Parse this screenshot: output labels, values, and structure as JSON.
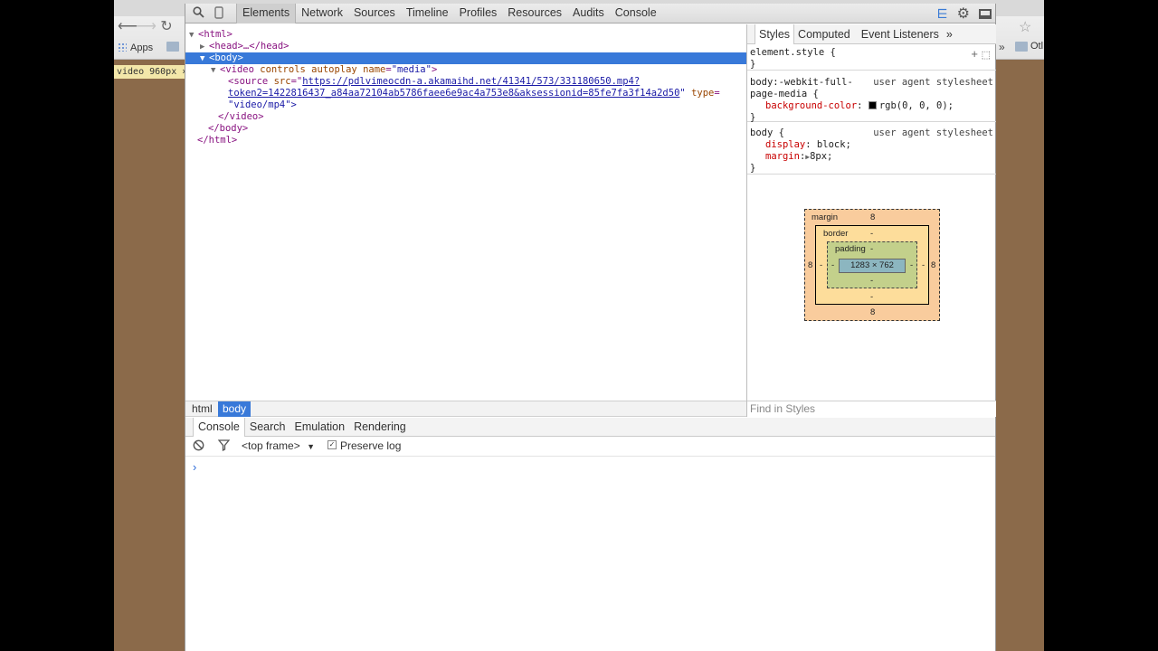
{
  "browser": {
    "bookmarks_apps": "Apps",
    "bookmarks_other": "Otl",
    "size_overlay": "video 960px ×"
  },
  "toolbar": {
    "tabs": [
      "Elements",
      "Network",
      "Sources",
      "Timeline",
      "Profiles",
      "Resources",
      "Audits",
      "Console"
    ]
  },
  "dom": {
    "html_open": "<html>",
    "head": "<head>…</head>",
    "body_open": "<body>",
    "video_tag": "<video",
    "video_attr1_name": "controls",
    "video_attr2_name": "autoplay",
    "video_attr3_name": "name",
    "video_attr3_val": "\"media\"",
    "video_close_bracket": ">",
    "source_tag": "<source",
    "source_src_name": "src",
    "source_src_url_line1": "https://pdlvimeocdn-a.akamaihd.net/41341/573/331180650.mp4?",
    "source_src_url_line2": "token2=1422816437_a84aa72104ab5786faee6e9ac4a753e8&aksessionid=85fe7fa3f14a2d50",
    "source_type_name": "type",
    "source_type_val": "\"video/mp4\">",
    "video_end": "</video>",
    "body_end": "</body>",
    "html_end": "</html>"
  },
  "breadcrumb": {
    "items": [
      "html",
      "body"
    ]
  },
  "sidebar": {
    "tabs": [
      "Styles",
      "Computed",
      "Event Listeners",
      "»"
    ],
    "rule1_selector": "element.style {",
    "rule1_close": "}",
    "rule2_selector_a": "body:-webkit-full-",
    "rule2_selector_b": "page-media {",
    "rule2_origin": "user agent stylesheet",
    "rule2_prop": "background-color",
    "rule2_val": "rgb(0, 0, 0);",
    "rule2_close": "}",
    "rule3_selector": "body {",
    "rule3_origin": "user agent stylesheet",
    "rule3_prop1": "display",
    "rule3_val1": "block;",
    "rule3_prop2": "margin",
    "rule3_val2": "8px;",
    "rule3_close": "}",
    "find_placeholder": "Find in Styles"
  },
  "boxmodel": {
    "margin_label": "margin",
    "margin_top": "8",
    "margin_bottom": "8",
    "margin_left": "8",
    "margin_right": "8",
    "border_label": "border",
    "border_top": "-",
    "border_bottom": "-",
    "border_left": "-",
    "border_right": "-",
    "padding_label": "padding",
    "padding_top": "-",
    "padding_bottom": "-",
    "padding_left": "-",
    "padding_right": "-",
    "content": "1283 × 762"
  },
  "drawer": {
    "tabs": [
      "Console",
      "Search",
      "Emulation",
      "Rendering"
    ],
    "frame_select": "<top frame>",
    "preserve_log": "Preserve log",
    "prompt": "›"
  },
  "colors": {
    "selection": "#3879d9",
    "tag": "#881280",
    "attr_name": "#994500",
    "attr_value": "#1a1aa6",
    "css_prop": "#c80000"
  }
}
